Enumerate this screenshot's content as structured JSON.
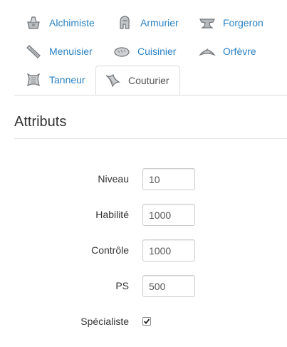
{
  "tabs": [
    {
      "label": "Alchimiste",
      "icon": "alchemist-cauldron-icon",
      "active": false
    },
    {
      "label": "Armurier",
      "icon": "armorer-helmet-icon",
      "active": false
    },
    {
      "label": "Forgeron",
      "icon": "blacksmith-anvil-icon",
      "active": false
    },
    {
      "label": "Menuisier",
      "icon": "carpenter-plank-icon",
      "active": false
    },
    {
      "label": "Cuisinier",
      "icon": "cook-bread-icon",
      "active": false
    },
    {
      "label": "Orfèvre",
      "icon": "jeweler-tiara-icon",
      "active": false
    },
    {
      "label": "Tanneur",
      "icon": "tanner-hide-icon",
      "active": false
    },
    {
      "label": "Couturier",
      "icon": "tailor-cloth-icon",
      "active": true
    }
  ],
  "section": {
    "title": "Attributs"
  },
  "form": {
    "niveau": {
      "label": "Niveau",
      "value": "10"
    },
    "habilete": {
      "label": "Habilité",
      "value": "1000"
    },
    "controle": {
      "label": "Contrôle",
      "value": "1000"
    },
    "ps": {
      "label": "PS",
      "value": "500"
    },
    "specialiste": {
      "label": "Spécialiste",
      "checked": true
    }
  },
  "colors": {
    "link": "#2a82c5",
    "active_text": "#555555",
    "border": "#dddddd"
  }
}
